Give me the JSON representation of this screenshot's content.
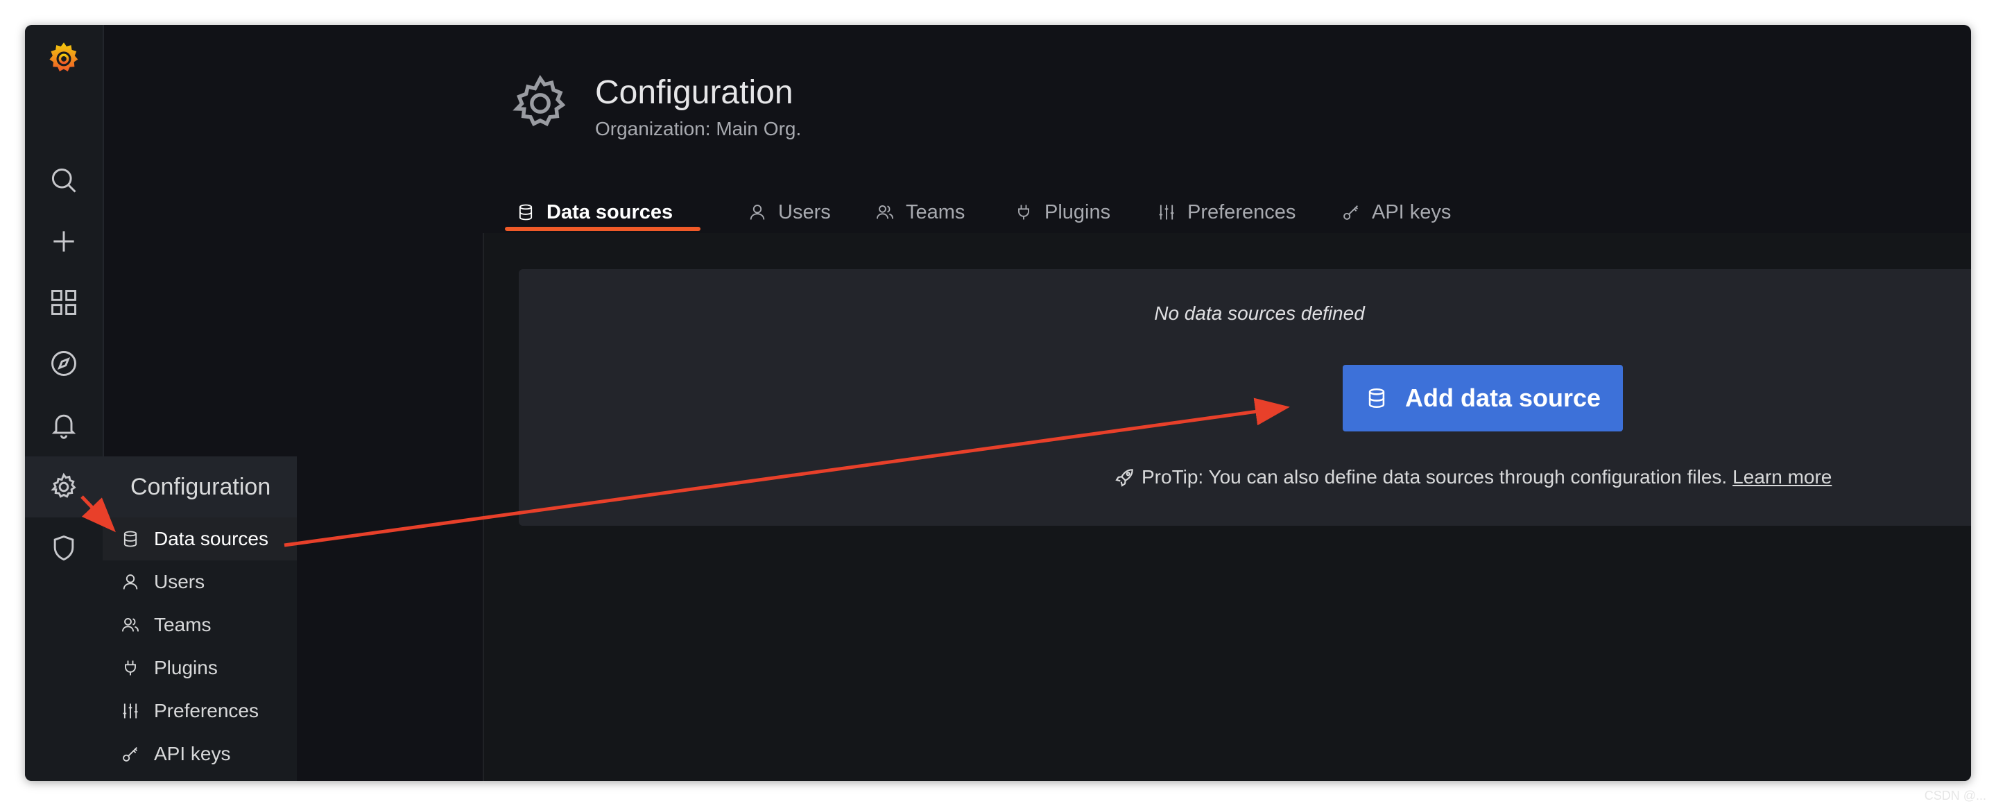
{
  "page": {
    "title": "Configuration",
    "subtitle": "Organization: Main Org."
  },
  "sidebar": {
    "icons": [
      {
        "name": "grafana-logo-icon"
      },
      {
        "name": "search-icon"
      },
      {
        "name": "plus-icon"
      },
      {
        "name": "dashboards-icon"
      },
      {
        "name": "explore-compass-icon"
      },
      {
        "name": "alerting-bell-icon"
      },
      {
        "name": "configuration-gear-icon"
      },
      {
        "name": "server-admin-shield-icon"
      }
    ]
  },
  "flyout": {
    "header": "Configuration",
    "items": [
      {
        "label": "Data sources",
        "icon": "database-icon",
        "active": true
      },
      {
        "label": "Users",
        "icon": "user-icon"
      },
      {
        "label": "Teams",
        "icon": "users-icon"
      },
      {
        "label": "Plugins",
        "icon": "plug-icon"
      },
      {
        "label": "Preferences",
        "icon": "sliders-icon"
      },
      {
        "label": "API keys",
        "icon": "key-icon"
      }
    ]
  },
  "tabs": [
    {
      "label": "Data sources",
      "icon": "database-icon",
      "active": true
    },
    {
      "label": "Users",
      "icon": "user-icon"
    },
    {
      "label": "Teams",
      "icon": "users-icon"
    },
    {
      "label": "Plugins",
      "icon": "plug-icon"
    },
    {
      "label": "Preferences",
      "icon": "sliders-icon"
    },
    {
      "label": "API keys",
      "icon": "key-icon"
    }
  ],
  "empty_state": {
    "message": "No data sources defined",
    "button_label": "Add data source",
    "protip": "ProTip: You can also define data sources through configuration files.",
    "learn_more": "Learn more"
  },
  "watermark": "CSDN @...",
  "colors": {
    "accent_orange": "#f05a28",
    "primary_blue": "#3d71d9",
    "annotation_red": "#e8402a",
    "background": "#111217"
  }
}
